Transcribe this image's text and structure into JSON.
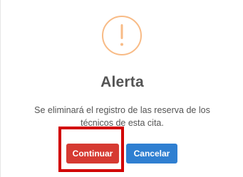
{
  "dialog": {
    "icon": "warning-exclamation-icon",
    "title": "Alerta",
    "message": "Se eliminará el registro de las reserva de los técnicos de esta cita.",
    "buttons": {
      "confirm_label": "Continuar",
      "cancel_label": "Cancelar"
    }
  },
  "colors": {
    "icon_ring": "#f8bb86",
    "confirm_button": "#d63a32",
    "cancel_button": "#2f7fd1",
    "highlight_box": "#d20000",
    "text": "#545454"
  }
}
